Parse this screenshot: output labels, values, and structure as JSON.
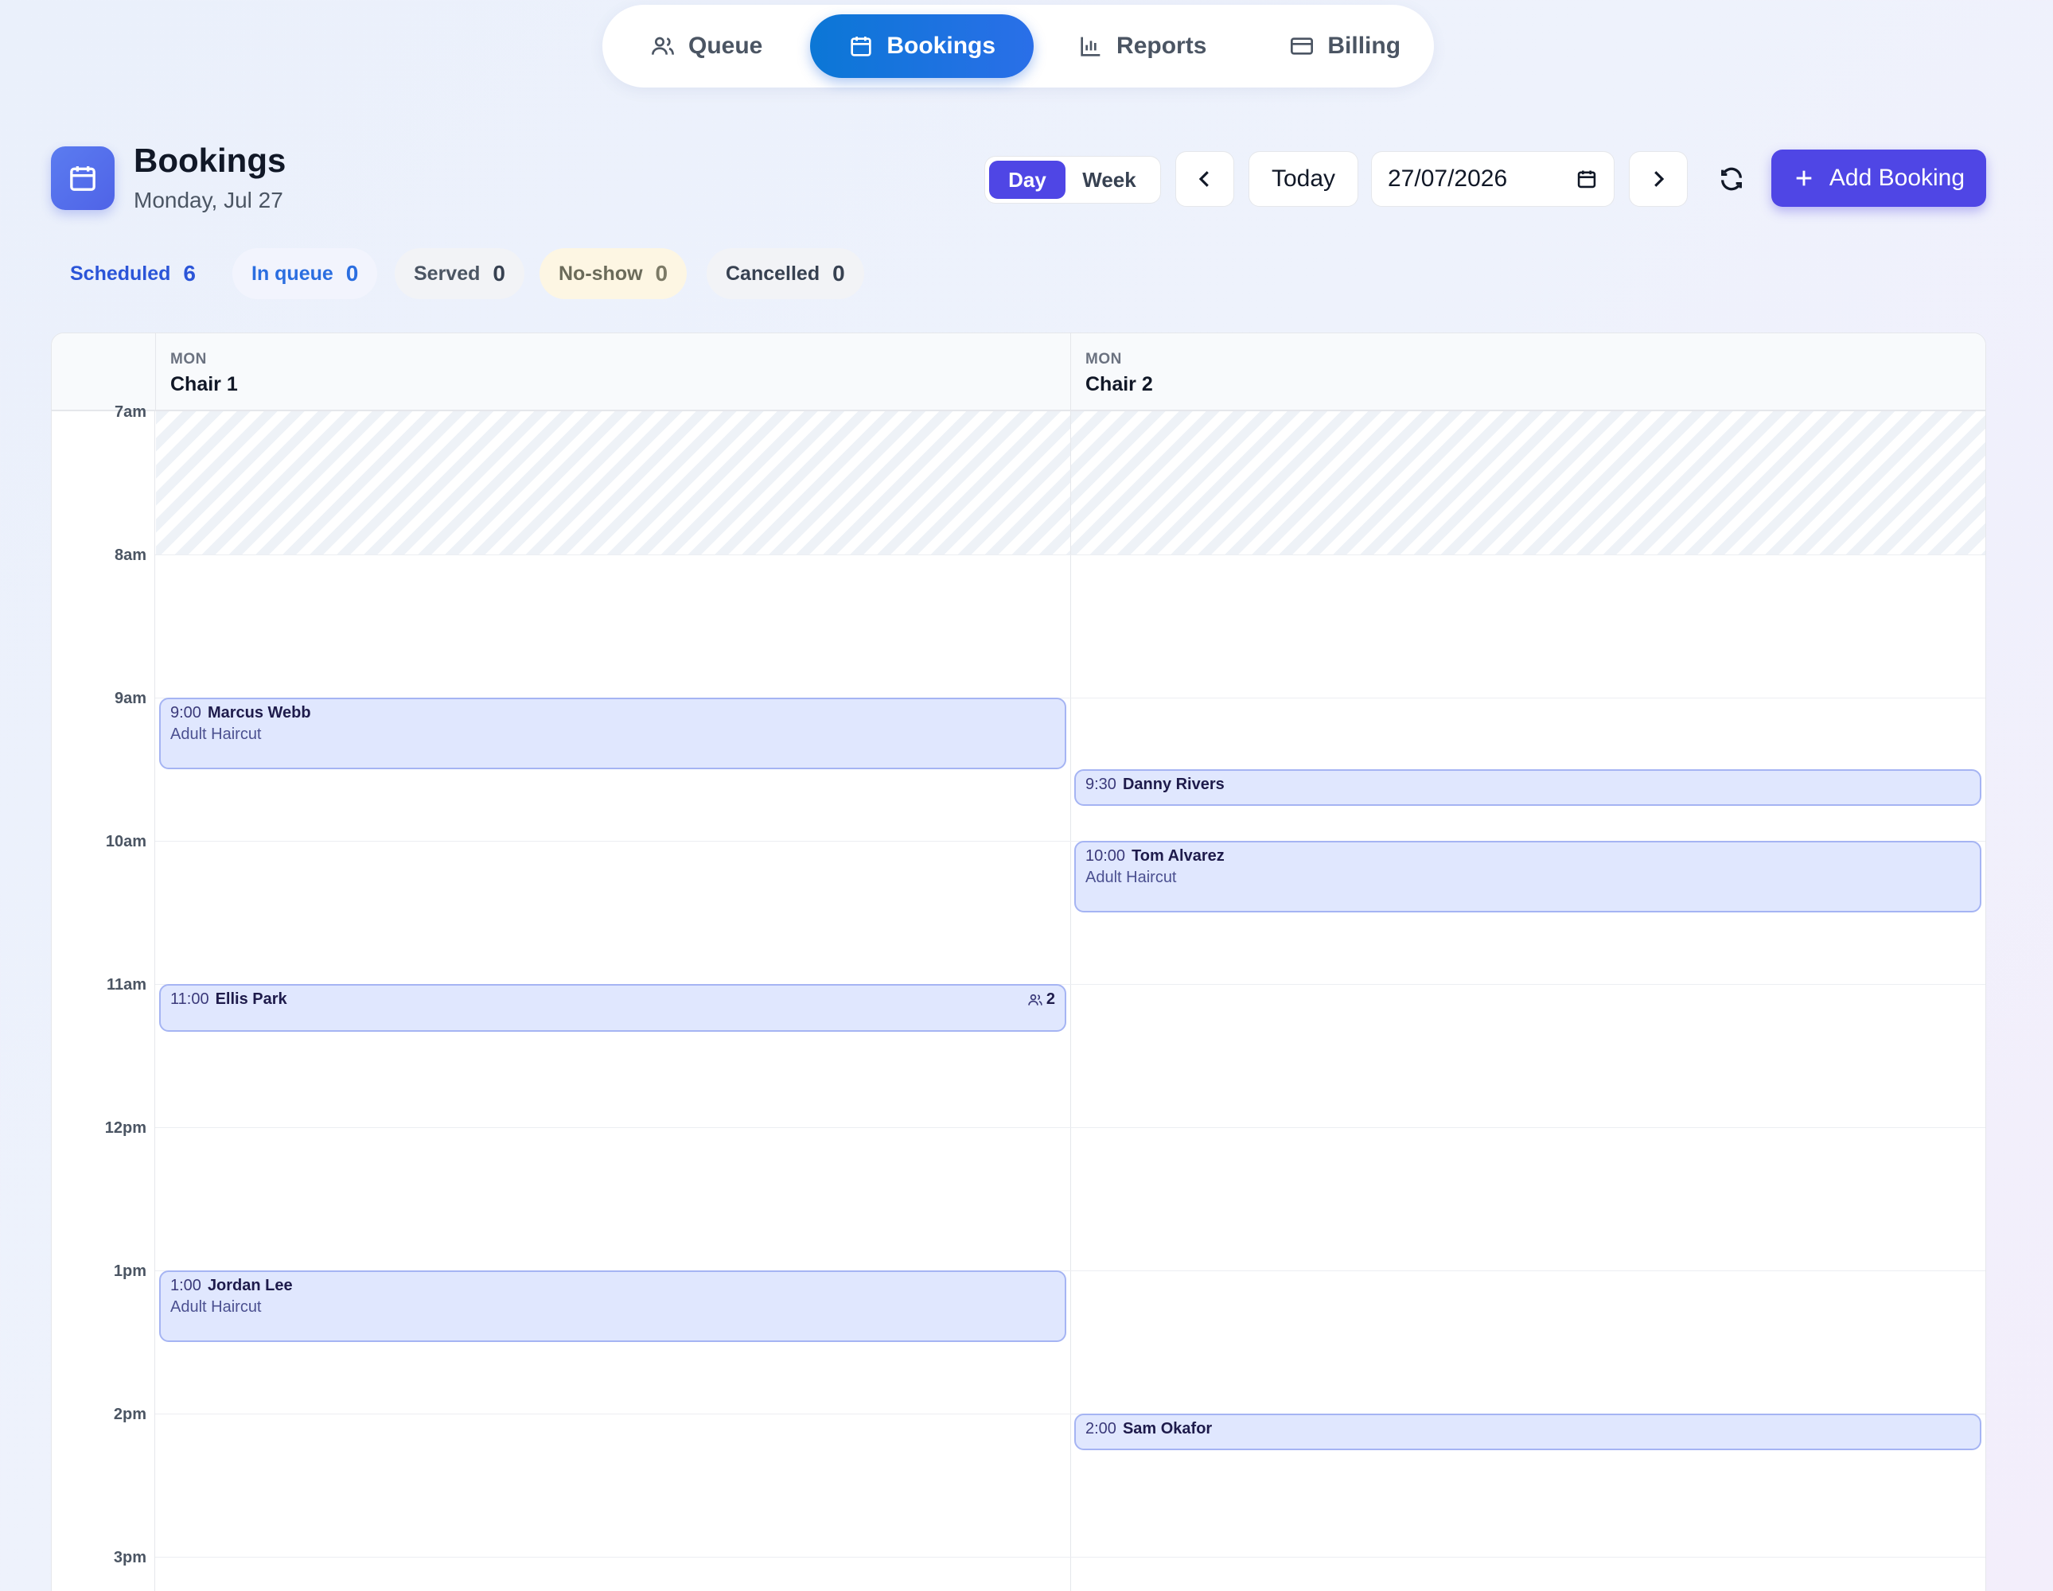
{
  "nav": {
    "tabs": [
      {
        "label": "Queue",
        "icon": "users-icon",
        "active": false
      },
      {
        "label": "Bookings",
        "icon": "calendar-icon",
        "active": true
      },
      {
        "label": "Reports",
        "icon": "bar-chart-icon",
        "active": false
      },
      {
        "label": "Billing",
        "icon": "credit-card-icon",
        "active": false
      }
    ]
  },
  "header": {
    "title": "Bookings",
    "subtitle": "Monday, Jul 27",
    "icon": "calendar-icon"
  },
  "toolbar": {
    "view_day": "Day",
    "view_week": "Week",
    "active_view": "Day",
    "today_label": "Today",
    "date_value": "27/07/2026",
    "add_label": "Add Booking"
  },
  "status": {
    "scheduled": {
      "label": "Scheduled",
      "count": "6"
    },
    "in_queue": {
      "label": "In queue",
      "count": "0"
    },
    "served": {
      "label": "Served",
      "count": "0"
    },
    "no_show": {
      "label": "No-show",
      "count": "0"
    },
    "cancelled": {
      "label": "Cancelled",
      "count": "0"
    }
  },
  "calendar": {
    "columns": [
      {
        "dow": "MON",
        "name": "Chair 1"
      },
      {
        "dow": "MON",
        "name": "Chair 2"
      }
    ],
    "hours": [
      "7am",
      "8am",
      "9am",
      "10am",
      "11am",
      "12pm",
      "1pm",
      "2pm",
      "3pm"
    ],
    "bookings": [
      {
        "column": 0,
        "time": "9:00",
        "name": "Marcus Webb",
        "service": "Adult Haircut",
        "party": ""
      },
      {
        "column": 1,
        "time": "9:30",
        "name": "Danny Rivers",
        "service": "",
        "party": ""
      },
      {
        "column": 1,
        "time": "10:00",
        "name": "Tom Alvarez",
        "service": "Adult Haircut",
        "party": ""
      },
      {
        "column": 0,
        "time": "11:00",
        "name": "Ellis Park",
        "service": "",
        "party": "2"
      },
      {
        "column": 0,
        "time": "1:00",
        "name": "Jordan Lee",
        "service": "Adult Haircut",
        "party": ""
      },
      {
        "column": 1,
        "time": "2:00",
        "name": "Sam Okafor",
        "service": "",
        "party": ""
      }
    ]
  },
  "colors": {
    "accent": "#4f46e5",
    "nav_active": "#0b77d6",
    "event_bg": "#e0e7fe",
    "event_border": "#a5b4f3"
  }
}
